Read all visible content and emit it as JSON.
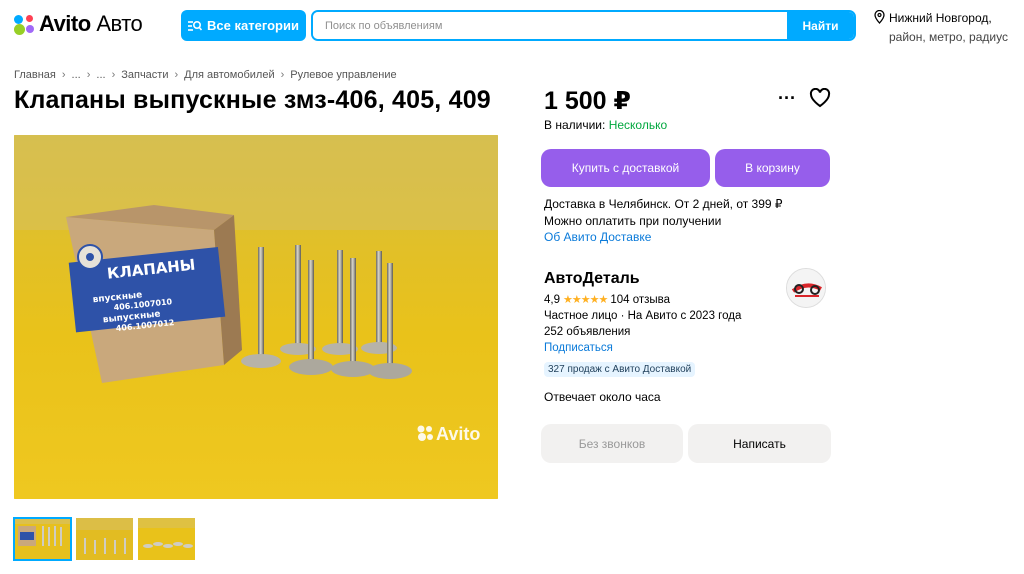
{
  "header": {
    "logo_brand": "Avito",
    "logo_suffix": "Авто",
    "categories_label": "Все категории",
    "search_placeholder": "Поиск по объявлениям",
    "search_button": "Найти",
    "location_city": "Нижний Новгород,",
    "location_hint": "район, метро, радиус"
  },
  "breadcrumbs": [
    "Главная",
    "...",
    "...",
    "Запчасти",
    "Для автомобилей",
    "Рулевое управление"
  ],
  "listing": {
    "title": "Клапаны выпускные змз-406, 405, 409",
    "price": "1 500 ₽",
    "stock_label": "В наличии:",
    "stock_value": "Несколько",
    "photo_watermark": "Avito",
    "box_label": "КЛАПАНЫ",
    "box_line1": "впускные",
    "box_line2": "406.1007010",
    "box_line3": "выпускные",
    "box_line4": "406.1007012"
  },
  "actions": {
    "buy_delivery": "Купить с доставкой",
    "add_to_cart": "В корзину",
    "no_calls": "Без звонков",
    "write": "Написать",
    "more": "···"
  },
  "delivery": {
    "line1": "Доставка в Челябинск. От 2 дней, от 399 ₽",
    "line2": "Можно оплатить при получении",
    "link": "Об Авито Доставке"
  },
  "seller": {
    "name": "АвтоДеталь",
    "rating": "4,9",
    "stars": "★★★★★",
    "reviews": "104 отзыва",
    "type": "Частное лицо · На Авито с 2023 года",
    "ads": "252 объявления",
    "subscribe": "Подписаться",
    "badge": "327 продаж с Авито Доставкой",
    "response": "Отвечает около часа"
  },
  "colors": {
    "accent_blue": "#00aaff",
    "purple": "#965eeb",
    "green": "#02a83f",
    "link": "#0a7ad9"
  }
}
